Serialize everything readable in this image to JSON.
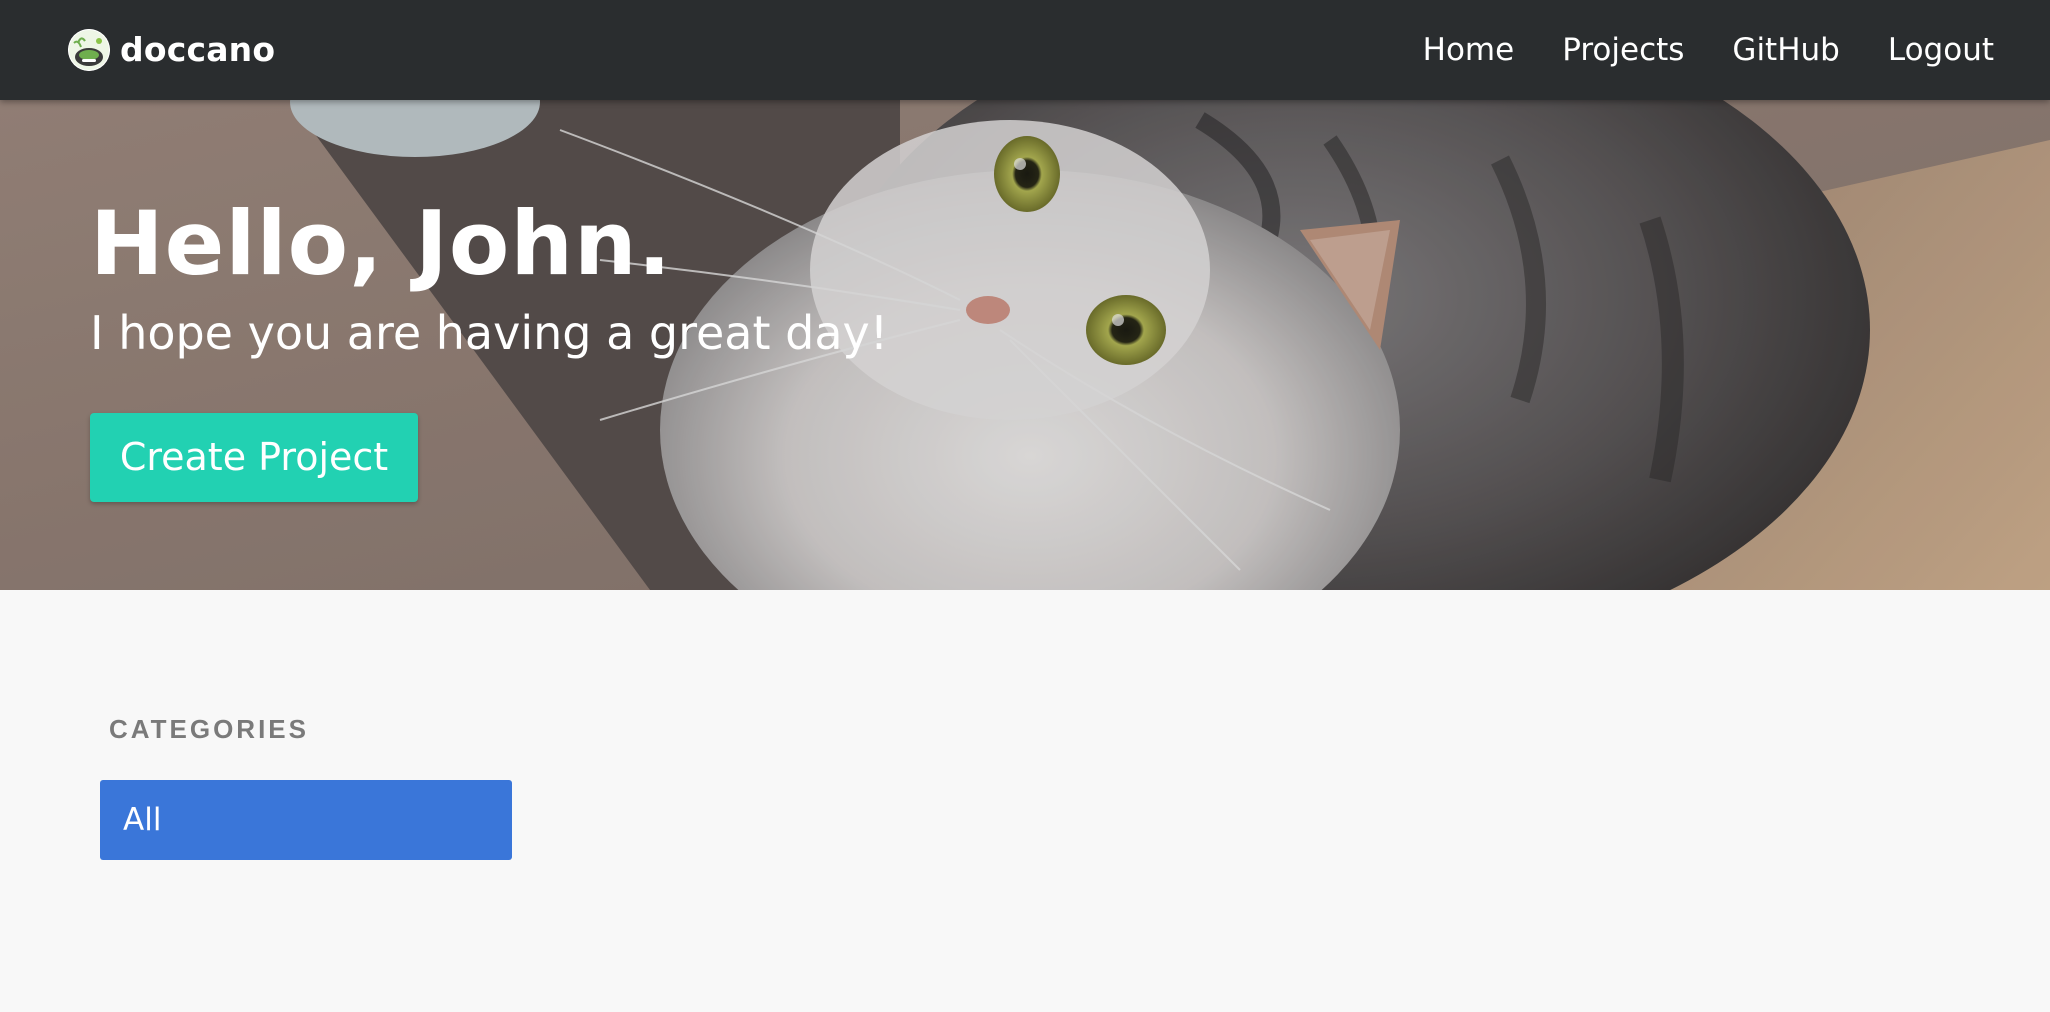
{
  "navbar": {
    "brand": "doccano",
    "links": [
      {
        "label": "Home"
      },
      {
        "label": "Projects"
      },
      {
        "label": "GitHub"
      },
      {
        "label": "Logout"
      }
    ]
  },
  "hero": {
    "title": "Hello, John.",
    "subtitle": "I hope you are having a great day!",
    "button_label": "Create Project",
    "button_color": "#22d1b2"
  },
  "categories": {
    "heading": "CATEGORIES",
    "items": [
      {
        "label": "All",
        "selected": true
      }
    ],
    "selected_color": "#3a76d9"
  }
}
